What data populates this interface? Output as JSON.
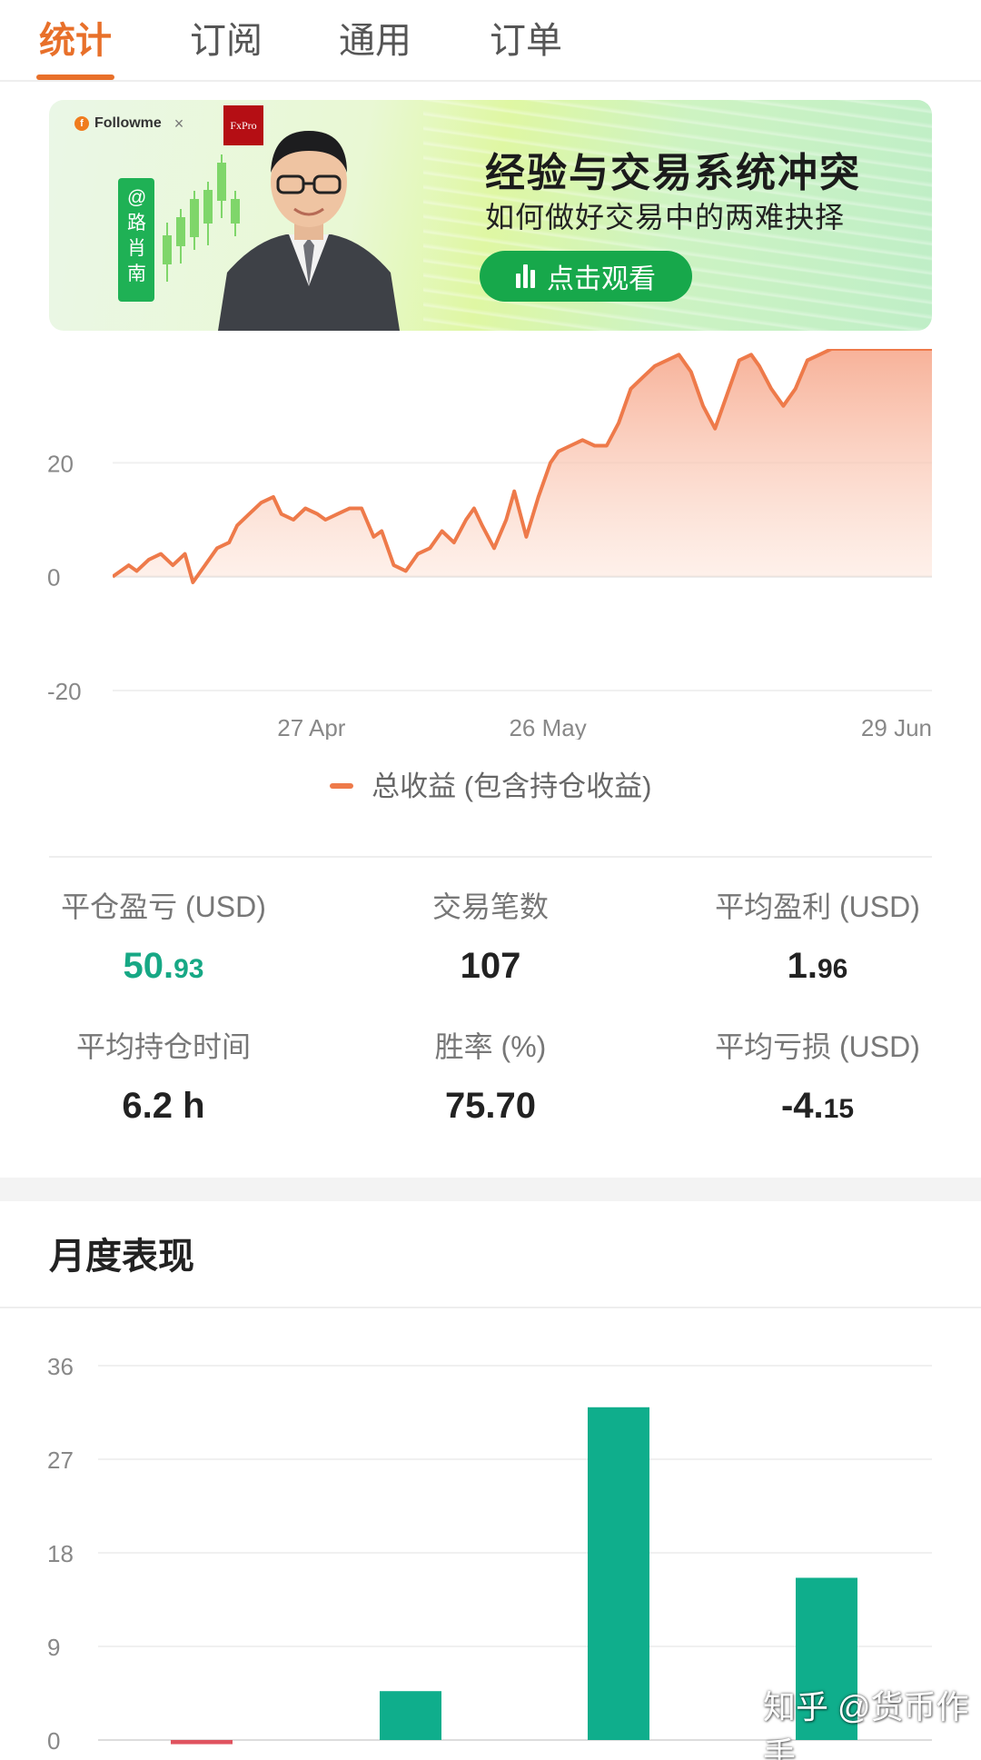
{
  "tabs": [
    "统计",
    "订阅",
    "通用",
    "订单"
  ],
  "active_tab": 0,
  "banner": {
    "brand": "Followme",
    "partner": "FxPro",
    "name_tag": "@路肖南",
    "title": "经验与交易系统冲突",
    "subtitle": "如何做好交易中的两难抉择",
    "button": "点击观看",
    "colors": {
      "button": "#17a84b",
      "name_tag": "#1fb155",
      "partner_logo": "#b50e14"
    }
  },
  "chart_data": [
    {
      "type": "area",
      "ylim": [
        -20,
        40
      ],
      "yticks": [
        "20",
        "0",
        "-20"
      ],
      "xticks": [
        "27 Apr",
        "26 May",
        "29 Jun"
      ],
      "legend": [
        "总收益 (包含持仓收益)"
      ],
      "legend_position": "bottom",
      "color": "#ee7a4a",
      "x": [
        0,
        4,
        6,
        9,
        12,
        15,
        18,
        20,
        23,
        26,
        29,
        31,
        34,
        37,
        40,
        42,
        45,
        48,
        51,
        53,
        56,
        59,
        62,
        65,
        67,
        70,
        73,
        76,
        79,
        82,
        85,
        88,
        90,
        92,
        95,
        98,
        100,
        103,
        106,
        109,
        111,
        114,
        117,
        120,
        123,
        126,
        129,
        132,
        135,
        138,
        141,
        144,
        147,
        150,
        153,
        156,
        159,
        161,
        164,
        167,
        170,
        173,
        176,
        179,
        182,
        185,
        188,
        191,
        193,
        196,
        199,
        202,
        204
      ],
      "values": [
        0,
        2,
        1,
        3,
        4,
        2,
        4,
        -1,
        2,
        5,
        6,
        9,
        11,
        13,
        14,
        11,
        10,
        12,
        11,
        10,
        11,
        12,
        12,
        7,
        8,
        2,
        1,
        4,
        5,
        8,
        6,
        10,
        12,
        9,
        5,
        10,
        15,
        7,
        14,
        20,
        22,
        23,
        24,
        23,
        23,
        27,
        33,
        35,
        37,
        38,
        39,
        36,
        30,
        26,
        32,
        38,
        39,
        37,
        33,
        30,
        33,
        38,
        39,
        40,
        40,
        40,
        40,
        40,
        40,
        40,
        40,
        40,
        40
      ]
    },
    {
      "type": "bar",
      "ylim": [
        0,
        36
      ],
      "yticks": [
        "36",
        "27",
        "18",
        "9",
        "0"
      ],
      "categories": [
        "",
        "",
        "",
        ""
      ],
      "values": [
        -0.4,
        4.7,
        32.0,
        15.6
      ],
      "colors": {
        "positive": "#0fae8c",
        "negative": "#e0535f"
      }
    }
  ],
  "stats": [
    {
      "label": "平仓盈亏 (USD)",
      "int": "50.",
      "dec": "93",
      "accent": "#17a885"
    },
    {
      "label": "交易笔数",
      "int": "107",
      "dec": ""
    },
    {
      "label": "平均盈利 (USD)",
      "int": "1.",
      "dec": "96"
    },
    {
      "label": "平均持仓时间",
      "int": "6.2 h",
      "dec": ""
    },
    {
      "label": "胜率 (%)",
      "int": "75.70",
      "dec": ""
    },
    {
      "label": "平均亏损 (USD)",
      "int": "-4.",
      "dec": "15"
    }
  ],
  "monthly": {
    "title": "月度表现"
  },
  "watermark": "知乎 @货币作手",
  "colors": {
    "accent": "#e8702a",
    "positive": "#17a885",
    "negative": "#e0535f"
  }
}
